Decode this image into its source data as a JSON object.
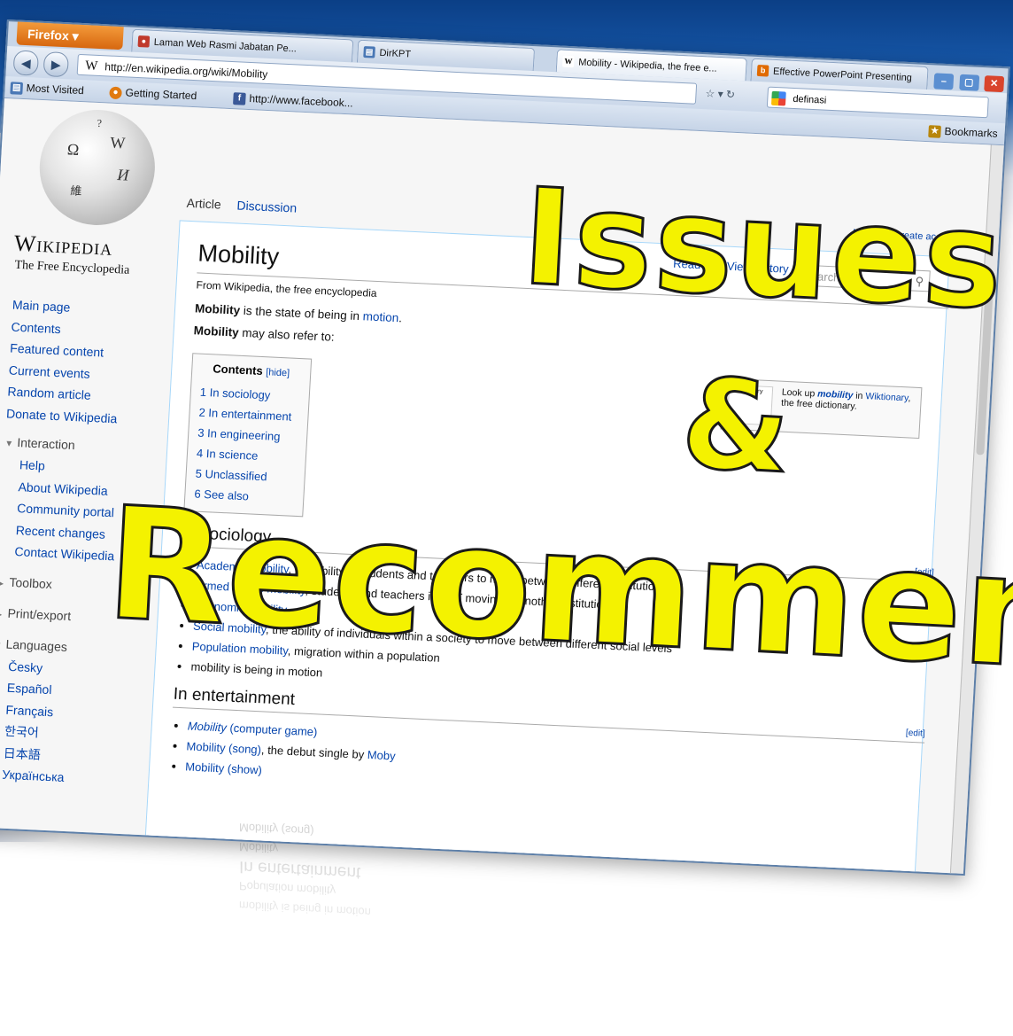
{
  "browser": {
    "app_button": "Firefox",
    "tabs": [
      {
        "label": "Laman Web Rasmi Jabatan Pe...",
        "favicon": "red-globe-icon"
      },
      {
        "label": "DirKPT",
        "favicon": "page-icon"
      },
      {
        "label": "Mobility - Wikipedia, the free e...",
        "favicon": "wikipedia-icon",
        "active": true
      },
      {
        "label": "Effective PowerPoint Presenting",
        "favicon": "b-icon"
      }
    ],
    "url": "http://en.wikipedia.org/wiki/Mobility",
    "search_value": "definasi",
    "bookmarks": [
      {
        "label": "Most Visited",
        "icon": "most-visited-icon"
      },
      {
        "label": "Getting Started",
        "icon": "firefox-icon"
      },
      {
        "label": "http://www.facebook...",
        "icon": "facebook-icon"
      }
    ],
    "bookmarks_right": "Bookmarks"
  },
  "wiki": {
    "logo_title": "Wikipedia",
    "logo_subtitle": "The Free Encyclopedia",
    "nav": [
      "Main page",
      "Contents",
      "Featured content",
      "Current events",
      "Random article",
      "Donate to Wikipedia"
    ],
    "interaction_label": "Interaction",
    "interaction": [
      "Help",
      "About Wikipedia",
      "Community portal",
      "Recent changes",
      "Contact Wikipedia"
    ],
    "toolbox_label": "Toolbox",
    "print_label": "Print/export",
    "languages_label": "Languages",
    "languages": [
      "Česky",
      "Español",
      "Français",
      "한국어",
      "日本語",
      "Українська"
    ],
    "tab_article": "Article",
    "tab_discussion": "Discussion",
    "user_link": "Log in / create account",
    "art_tabs": "Read  Edit  View history",
    "search_placeholder": "Search"
  },
  "article": {
    "title": "Mobility",
    "tagline": "From Wikipedia, the free encyclopedia",
    "lead_bold": "Mobility",
    "lead_text": " is the state of being in ",
    "lead_link": "motion",
    "lead_end": ".",
    "refer_bold": "Mobility",
    "refer_text": " may also refer to:",
    "wiktionary_pre": "Look up ",
    "wiktionary_link": "mobility",
    "wiktionary_mid": " in ",
    "wiktionary_link2": "Wiktionary",
    "wiktionary_post": ", the free dictionary.",
    "wiktionary_thumb": "Wiktionary",
    "toc_title": "Contents",
    "toc_hide": "[hide]",
    "toc": [
      "1 In sociology",
      "2 In entertainment",
      "3 In engineering",
      "4 In science",
      "5 Unclassified",
      "6 See also"
    ],
    "edit_label": "[edit]",
    "sections": [
      {
        "heading": "In sociology",
        "items": [
          {
            "link": "Academic mobility",
            "text": ", possibility of students and teachers to move between different institutions"
          },
          {
            "link": "Armed forces mobility",
            "text": ", students and teachers in VET moving to another institution"
          },
          {
            "link": "Economic mobility",
            "text": ""
          },
          {
            "link": "Social mobility",
            "text": ", the ability of individuals within a society to move between different social levels"
          },
          {
            "link": "Population mobility",
            "text": ", migration within a population"
          },
          {
            "link": "",
            "text": "mobility is being in motion"
          }
        ]
      },
      {
        "heading": "In entertainment",
        "items": [
          {
            "link": "Mobility",
            "text": " (computer game)",
            "italic": true
          },
          {
            "link": "Mobility (song)",
            "text": ", the debut single by ",
            "link2": "Moby"
          },
          {
            "link": "Mobility (show)",
            "text": ""
          }
        ]
      }
    ]
  },
  "overlay": {
    "line1": "Issues",
    "line2": "&",
    "line3": "Recommenda"
  },
  "colors": {
    "overlay_fill": "#f4f200",
    "overlay_stroke": "#1a1a1a",
    "link": "#0645ad",
    "slide_top": "#0b3f86"
  }
}
